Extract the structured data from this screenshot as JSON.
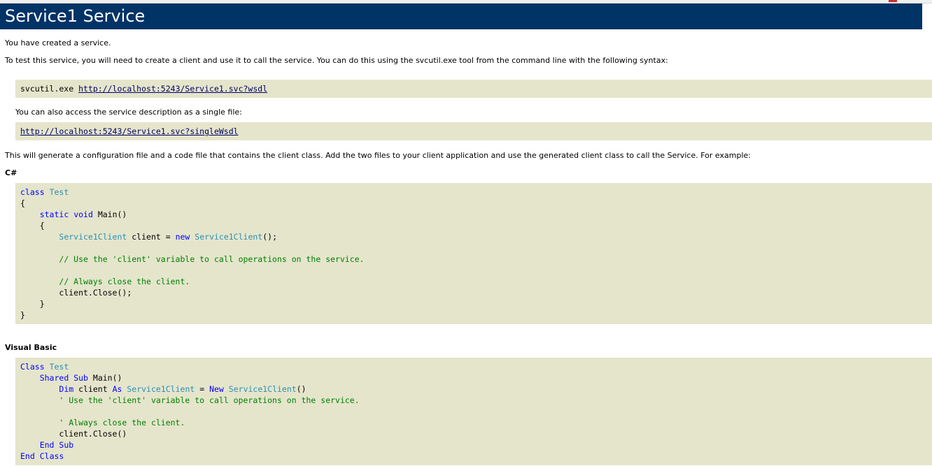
{
  "header": {
    "title": "Service1 Service"
  },
  "intro": {
    "created": "You have created a service.",
    "test_instructions": "To test this service, you will need to create a client and use it to call the service. You can do this using the svcutil.exe tool from the command line with the following syntax:",
    "svcutil_cmd": "svcutil.exe ",
    "wsdl_url": "http://localhost:5243/Service1.svc?wsdl",
    "single_file_text": "You can also access the service description as a single file:",
    "single_wsdl_url": "http://localhost:5243/Service1.svc?singleWsdl",
    "generate_text": "This will generate a configuration file and a code file that contains the client class. Add the two files to your client application and use the generated client class to call the Service. For example:"
  },
  "csharp": {
    "heading": "C#"
  },
  "vb": {
    "heading": "Visual Basic"
  },
  "colors": {
    "banner": "#003366",
    "code_bg": "#e5e5cc",
    "keyword": "#0000ff",
    "type": "#2b91af",
    "comment": "#008000"
  }
}
